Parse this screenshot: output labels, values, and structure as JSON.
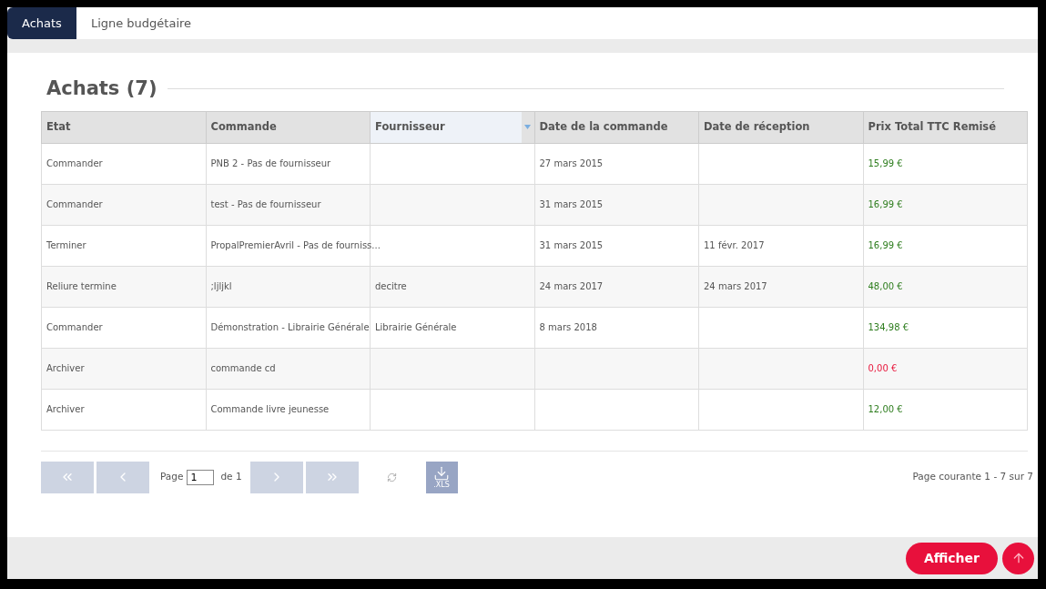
{
  "tabs": [
    {
      "label": "Achats",
      "selected": true
    },
    {
      "label": "Ligne budgétaire",
      "selected": false
    }
  ],
  "title": "Achats (7)",
  "table": {
    "columns": [
      {
        "label": "Etat",
        "sorted": false
      },
      {
        "label": "Commande",
        "sorted": false
      },
      {
        "label": "Fournisseur",
        "sorted": true
      },
      {
        "label": "Date de la commande",
        "sorted": false
      },
      {
        "label": "Date de réception",
        "sorted": false
      },
      {
        "label": "Prix Total TTC Remisé",
        "sorted": false
      }
    ],
    "rows": [
      {
        "cells": [
          "Commander",
          "PNB 2 - Pas de fournisseur",
          "",
          "27 mars 2015",
          ""
        ],
        "price": "15,99 €",
        "color": "#2e7d1e"
      },
      {
        "cells": [
          "Commander",
          "test - Pas de fournisseur",
          "",
          "31 mars 2015",
          ""
        ],
        "price": "16,99 €",
        "color": "#2e7d1e"
      },
      {
        "cells": [
          "Terminer",
          "PropalPremierAvril - Pas de fourniss...",
          "",
          "31 mars 2015",
          "11 févr. 2017"
        ],
        "price": "16,99 €",
        "color": "#2e7d1e"
      },
      {
        "cells": [
          "Reliure termine",
          ";ljljkl",
          "decitre",
          "24 mars 2017",
          "24 mars 2017"
        ],
        "price": "48,00 €",
        "color": "#2e7d1e"
      },
      {
        "cells": [
          "Commander",
          "Démonstration - Librairie Générale",
          "Librairie Générale",
          "8 mars 2018",
          ""
        ],
        "price": "134,98 €",
        "color": "#2e7d1e"
      },
      {
        "cells": [
          "Archiver",
          "commande cd",
          "",
          "",
          ""
        ],
        "price": "0,00 €",
        "color": "#e8173c"
      },
      {
        "cells": [
          "Archiver",
          "Commande livre jeunesse",
          "",
          "",
          ""
        ],
        "price": "12,00 €",
        "color": "#2e7d1e"
      }
    ]
  },
  "pager": {
    "page_label": "Page",
    "page_value": "1",
    "of_label": "de 1",
    "export_label": ".XLS",
    "summary": "Page courante 1 - 7 sur 7"
  },
  "footer": {
    "button": "Afficher"
  }
}
